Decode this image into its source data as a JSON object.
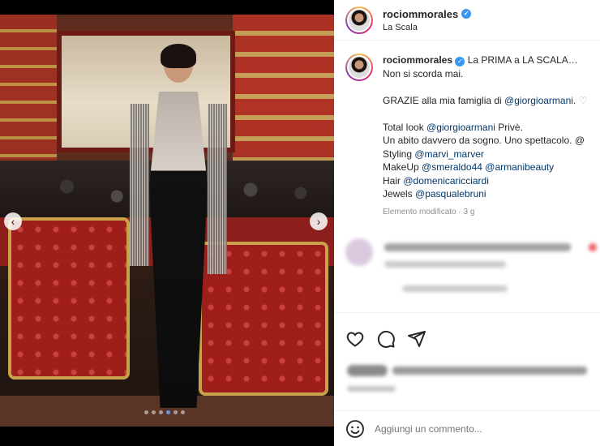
{
  "post": {
    "carousel": {
      "slide_count": 6,
      "active_index": 3
    },
    "colors": {
      "accent": "#3897f0",
      "mention": "#00376b",
      "muted": "#8e8e8e"
    }
  },
  "header": {
    "username": "rociommorales",
    "location": "La Scala"
  },
  "caption": {
    "username": "rociommorales",
    "lines": [
      "La PRIMA a LA SCALA…",
      "Non si scorda mai.",
      "",
      "GRAZIE alla mia famiglia di ",
      "",
      "Total look ",
      "Un abito davvero da sogno. Uno spettacolo. @",
      "Styling ",
      "MakeUp ",
      "Hair ",
      "Jewels "
    ],
    "mentions": {
      "grazie": "@giorgioarmani.",
      "total_look": "@giorgioarmani",
      "total_look_suffix": " Privè.",
      "styling": "@marvi_marver",
      "makeup_1": "@smeraldo44",
      "makeup_2": "@armanibeauty",
      "hair": "@domenicaricciardi",
      "jewels": "@pasqualebruni"
    },
    "meta": "Elemento modificato · 3 g"
  },
  "add_comment": {
    "placeholder": "Aggiungi un commento..."
  },
  "icons": [
    "verified-icon",
    "heart-icon",
    "comment-icon",
    "share-icon",
    "emoji-icon",
    "chevron-left-icon",
    "chevron-right-icon"
  ]
}
